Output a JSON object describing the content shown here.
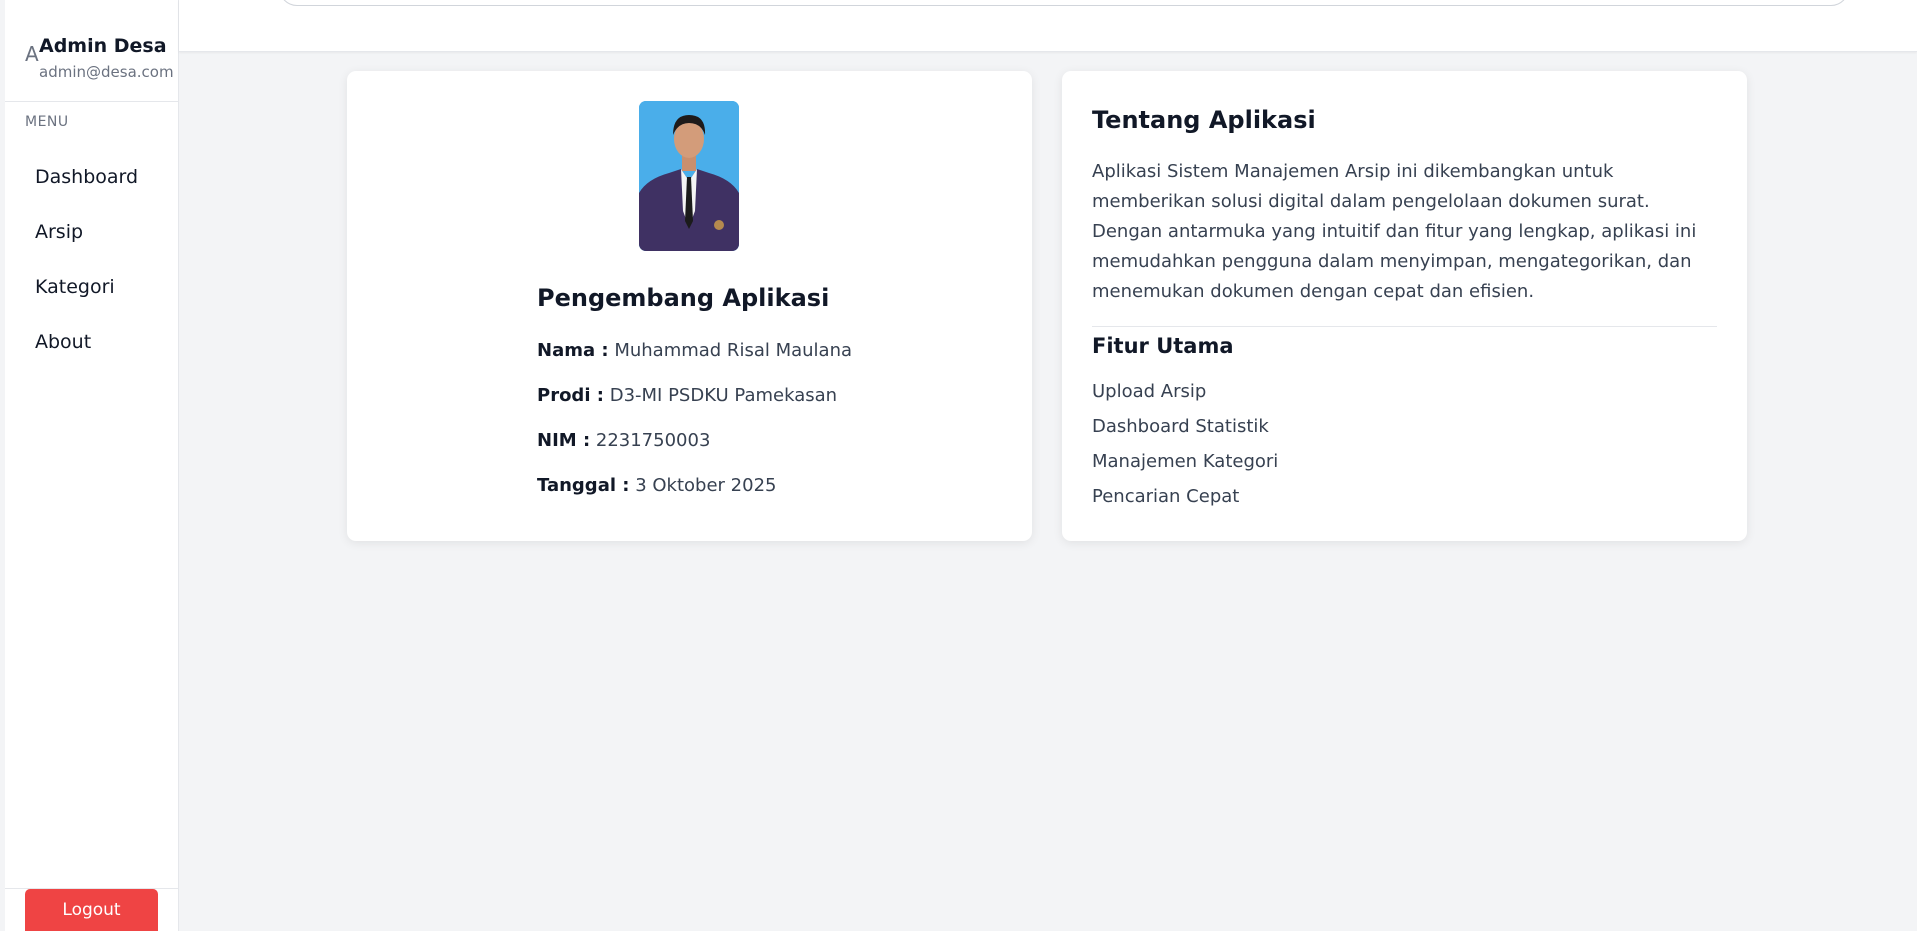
{
  "sidebar": {
    "avatar_letter": "A",
    "admin_name": "Admin Desa",
    "admin_email": "admin@desa.com",
    "menu_label": "MENU",
    "items": [
      {
        "label": "Dashboard"
      },
      {
        "label": "Arsip"
      },
      {
        "label": "Kategori"
      },
      {
        "label": "About"
      }
    ],
    "logout_label": "Logout"
  },
  "developer": {
    "title": "Pengembang Aplikasi",
    "nama_label": "Nama :",
    "nama_value": "Muhammad Risal Maulana",
    "prodi_label": "Prodi :",
    "prodi_value": "D3-MI PSDKU Pamekasan",
    "nim_label": "NIM :",
    "nim_value": "2231750003",
    "tanggal_label": "Tanggal :",
    "tanggal_value": "3 Oktober 2025"
  },
  "about": {
    "title": "Tentang Aplikasi",
    "description": "Aplikasi Sistem Manajemen Arsip ini dikembangkan untuk memberikan solusi digital dalam pengelolaan dokumen surat. Dengan antarmuka yang intuitif dan fitur yang lengkap, aplikasi ini memudahkan pengguna dalam menyimpan, mengategorikan, dan menemukan dokumen dengan cepat dan efisien.",
    "features_title": "Fitur Utama",
    "features": [
      "Upload Arsip",
      "Dashboard Statistik",
      "Manajemen Kategori",
      "Pencarian Cepat"
    ]
  },
  "colors": {
    "logout": "#ef4444",
    "background": "#f3f4f6",
    "photo_background": "#4aaeea"
  }
}
